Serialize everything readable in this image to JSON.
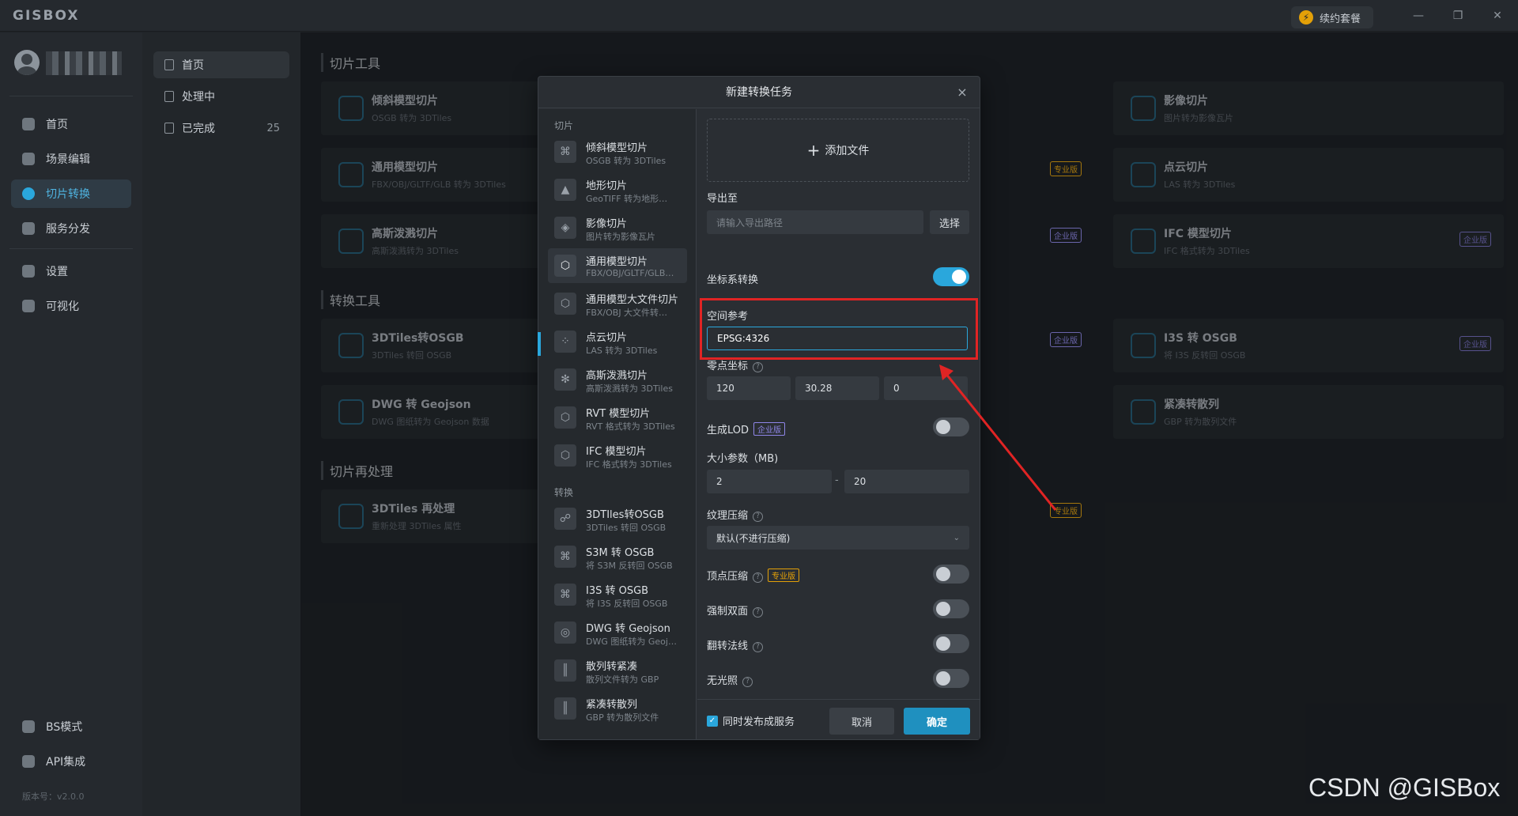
{
  "app": {
    "logo": "GISBOX",
    "renew_label": "续约套餐",
    "version": "版本号：v2.0.0"
  },
  "window_controls": {
    "minimize": "—",
    "restore": "❐",
    "close": "✕"
  },
  "sidebar": {
    "items": [
      {
        "label": "首页"
      },
      {
        "label": "场景编辑"
      },
      {
        "label": "切片转换"
      },
      {
        "label": "服务分发"
      },
      {
        "label": "设置"
      },
      {
        "label": "可视化"
      }
    ],
    "bottom": [
      {
        "label": "BS模式"
      },
      {
        "label": "API集成"
      }
    ]
  },
  "col2": {
    "items": [
      {
        "label": "首页"
      },
      {
        "label": "处理中"
      },
      {
        "label": "已完成",
        "count": "25"
      }
    ]
  },
  "main": {
    "sections": [
      "切片工具",
      "转换工具",
      "切片再处理"
    ],
    "cards": [
      {
        "title": "倾斜模型切片",
        "sub": "OSGB 转为 3DTiles"
      },
      {
        "title": "影像切片",
        "sub": "图片转为影像瓦片"
      },
      {
        "title": "通用模型切片",
        "sub": "FBX/OBJ/GLTF/GLB 转为 3DTiles"
      },
      {
        "title": "点云切片",
        "sub": "LAS 转为 3DTiles"
      },
      {
        "title": "高斯泼溅切片",
        "sub": "高斯泼溅转为 3DTiles"
      },
      {
        "title": "IFC 模型切片",
        "sub": "IFC 格式转为 3DTiles"
      },
      {
        "title": "3DTiles转OSGB",
        "sub": "3DTiles 转回 OSGB"
      },
      {
        "title": "I3S 转 OSGB",
        "sub": "将 I3S 反转回 OSGB"
      },
      {
        "title": "DWG 转 Geojson",
        "sub": "DWG 图纸转为 Geojson 数据"
      },
      {
        "title": "紧凑转散列",
        "sub": "GBP 转为散列文件"
      },
      {
        "title": "3DTiles 再处理",
        "sub": "重新处理 3DTiles 属性"
      }
    ],
    "badges": {
      "pro": "专业版",
      "ent": "企业版"
    }
  },
  "dialog": {
    "title": "新建转换任务",
    "close": "×",
    "group1": "切片",
    "group2": "转换",
    "list": [
      {
        "title": "倾斜模型切片",
        "sub": "OSGB 转为 3DTiles"
      },
      {
        "title": "地形切片",
        "sub": "GeoTIFF 转为地形…"
      },
      {
        "title": "影像切片",
        "sub": "图片转为影像瓦片"
      },
      {
        "title": "通用模型切片",
        "sub": "FBX/OBJ/GLTF/GLB…"
      },
      {
        "title": "通用模型大文件切片",
        "sub": "FBX/OBJ 大文件转…"
      },
      {
        "title": "点云切片",
        "sub": "LAS 转为 3DTiles"
      },
      {
        "title": "高斯泼溅切片",
        "sub": "高斯泼溅转为 3DTiles"
      },
      {
        "title": "RVT 模型切片",
        "sub": "RVT 格式转为 3DTiles"
      },
      {
        "title": "IFC 模型切片",
        "sub": "IFC 格式转为 3DTiles"
      },
      {
        "title": "3DTIles转OSGB",
        "sub": "3DTiles 转回 OSGB"
      },
      {
        "title": "S3M 转 OSGB",
        "sub": "将 S3M 反转回 OSGB"
      },
      {
        "title": "I3S 转 OSGB",
        "sub": "将 I3S 反转回 OSGB"
      },
      {
        "title": "DWG 转 Geojson",
        "sub": "DWG 图纸转为 Geoj…"
      },
      {
        "title": "散列转紧凑",
        "sub": "散列文件转为 GBP"
      },
      {
        "title": "紧凑转散列",
        "sub": "GBP 转为散列文件"
      }
    ],
    "add_file": "添加文件",
    "export_label": "导出至",
    "export_placeholder": "请输入导出路径",
    "choose": "选择",
    "crs_label": "坐标系转换",
    "crs_enabled": true,
    "spatial_ref_label": "空间参考",
    "spatial_ref_value": "EPSG:4326",
    "origin_label": "零点坐标",
    "origin": [
      "120",
      "30.28",
      "0"
    ],
    "lod_label": "生成LOD",
    "lod_enabled": false,
    "size_label": "大小参数（MB)",
    "size_min": "2",
    "size_sep": "-",
    "size_max": "20",
    "texture_label": "纹理压缩",
    "texture_value": "默认(不进行压缩)",
    "vertex_label": "顶点压缩",
    "vertex_enabled": false,
    "double_label": "强制双面",
    "double_enabled": false,
    "normal_label": "翻转法线",
    "normal_enabled": false,
    "unlit_label": "无光照",
    "unlit_enabled": false,
    "publish_label": "同时发布成服务",
    "publish_checked": true,
    "cancel": "取消",
    "ok": "确定"
  },
  "watermark": "CSDN @GISBox",
  "colors": {
    "accent": "#2aa7dc",
    "highlight": "#e02424",
    "pro": "#e3a008",
    "enterprise": "#8f86e8"
  }
}
